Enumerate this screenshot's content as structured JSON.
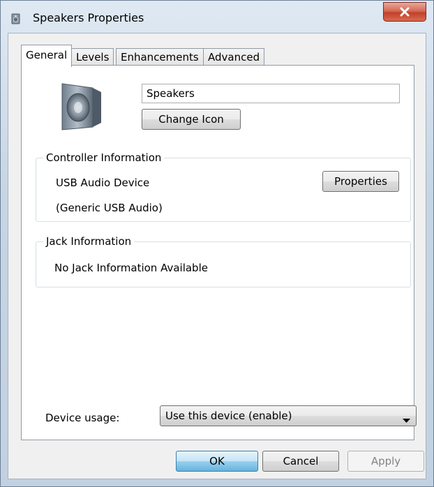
{
  "window": {
    "title": "Speakers Properties"
  },
  "tabs": [
    {
      "label": "General",
      "active": true
    },
    {
      "label": "Levels",
      "active": false
    },
    {
      "label": "Enhancements",
      "active": false
    },
    {
      "label": "Advanced",
      "active": false
    }
  ],
  "general": {
    "device_name": "Speakers",
    "change_icon_label": "Change Icon",
    "controller": {
      "title": "Controller Information",
      "device": "USB Audio Device",
      "driver": "(Generic USB Audio)",
      "properties_label": "Properties"
    },
    "jack": {
      "title": "Jack Information",
      "message": "No Jack Information Available"
    },
    "device_usage": {
      "label": "Device usage:",
      "selected": "Use this device (enable)"
    }
  },
  "buttons": {
    "ok": "OK",
    "cancel": "Cancel",
    "apply": "Apply"
  },
  "colors": {
    "close_button": "#c2412b",
    "ok_button_border": "#3c7fb1"
  },
  "icons": {
    "title": "speaker-icon",
    "device": "speaker-icon",
    "close": "close-icon",
    "dropdown": "chevron-down-icon"
  }
}
